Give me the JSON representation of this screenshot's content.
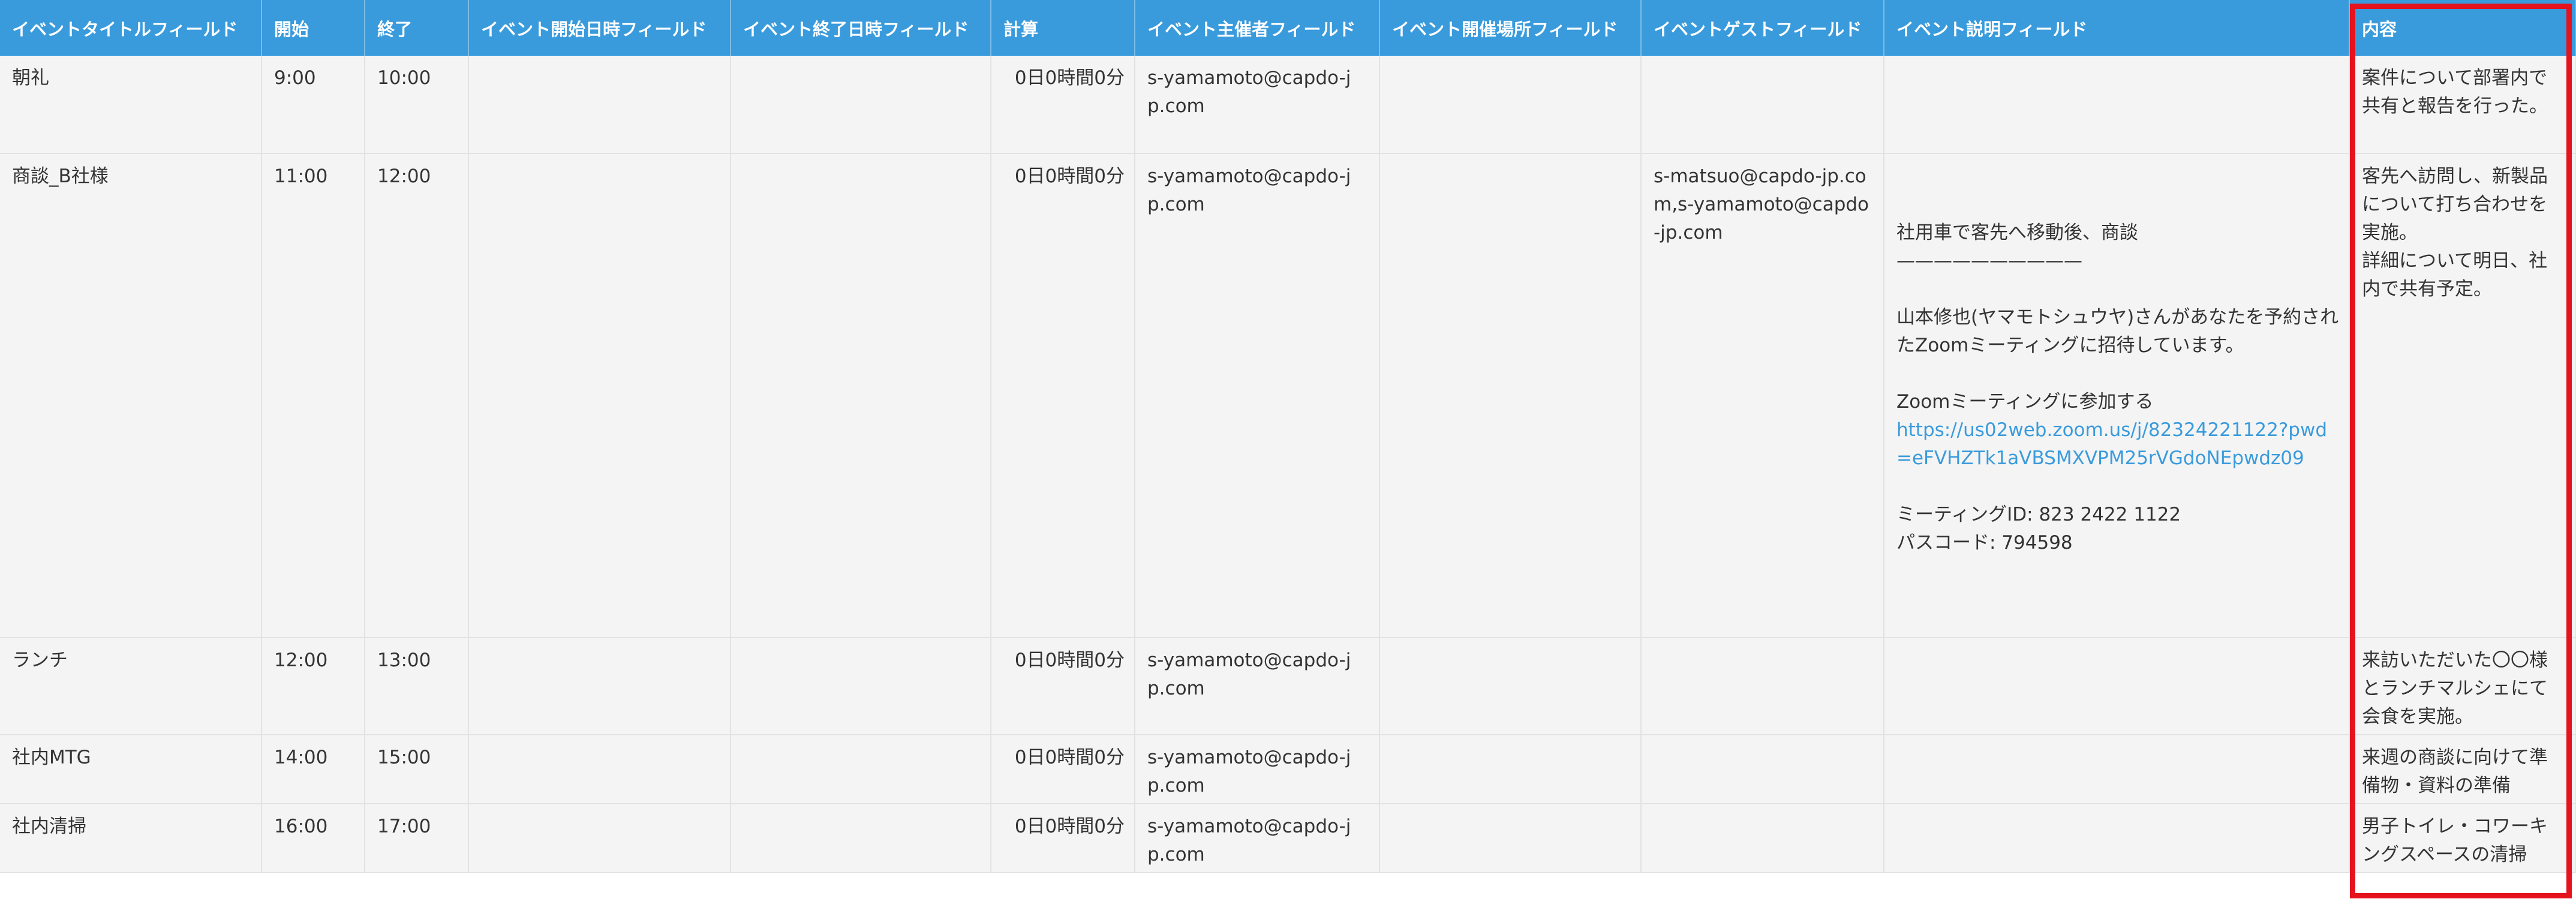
{
  "columns": {
    "title": "イベントタイトルフィールド",
    "start": "開始",
    "end": "終了",
    "start_datetime": "イベント開始日時フィールド",
    "end_datetime": "イベント終了日時フィールド",
    "calc": "計算",
    "organizer": "イベント主催者フィールド",
    "location": "イベント開催場所フィールド",
    "guests": "イベントゲストフィールド",
    "description": "イベント説明フィールド",
    "content": "内容"
  },
  "rows": [
    {
      "title": "朝礼",
      "start": "9:00",
      "end": "10:00",
      "calc": "0日0時間0分",
      "organizer": "s-yamamoto@capdo-jp.com",
      "guests": "",
      "content": "案件について部署内で共有と報告を行った。"
    },
    {
      "title": "商談_B社様",
      "start": "11:00",
      "end": "12:00",
      "calc": "0日0時間0分",
      "organizer": "s-yamamoto@capdo-jp.com",
      "guests": "s-matsuo@capdo-jp.com,s-yamamoto@capdo-jp.com",
      "content": "客先へ訪問し、新製品について打ち合わせを実施。\n詳細について明日、社内で共有予定。",
      "description": {
        "line1": "社用車で客先へ移動後、商談",
        "separator": "——————————",
        "invite": "山本修也(ヤマモトシュウヤ)さんがあなたを予約されたZoomミーティングに招待しています。",
        "join": "Zoomミーティングに参加する",
        "link": "https://us02web.zoom.us/j/82324221122?pwd=eFVHZTk1aVBSMXVPM25rVGdoNEpwdz09",
        "meeting_id": "ミーティングID: 823 2422 1122",
        "passcode": "パスコード: 794598"
      }
    },
    {
      "title": "ランチ",
      "start": "12:00",
      "end": "13:00",
      "calc": "0日0時間0分",
      "organizer": "s-yamamoto@capdo-jp.com",
      "guests": "",
      "content": "来訪いただいた〇〇様とランチマルシェにて会食を実施。"
    },
    {
      "title": "社内MTG",
      "start": "14:00",
      "end": "15:00",
      "calc": "0日0時間0分",
      "organizer": "s-yamamoto@capdo-jp.com",
      "guests": "",
      "content": "来週の商談に向けて準備物・資料の準備"
    },
    {
      "title": "社内清掃",
      "start": "16:00",
      "end": "17:00",
      "calc": "0日0時間0分",
      "organizer": "s-yamamoto@capdo-jp.com",
      "guests": "",
      "content": "男子トイレ・コワーキングスペースの清掃"
    }
  ],
  "colors": {
    "header_bg": "#3A9BDC",
    "row_bg": "#f4f4f4",
    "link": "#3A9BDC",
    "highlight": "#e4131d"
  }
}
